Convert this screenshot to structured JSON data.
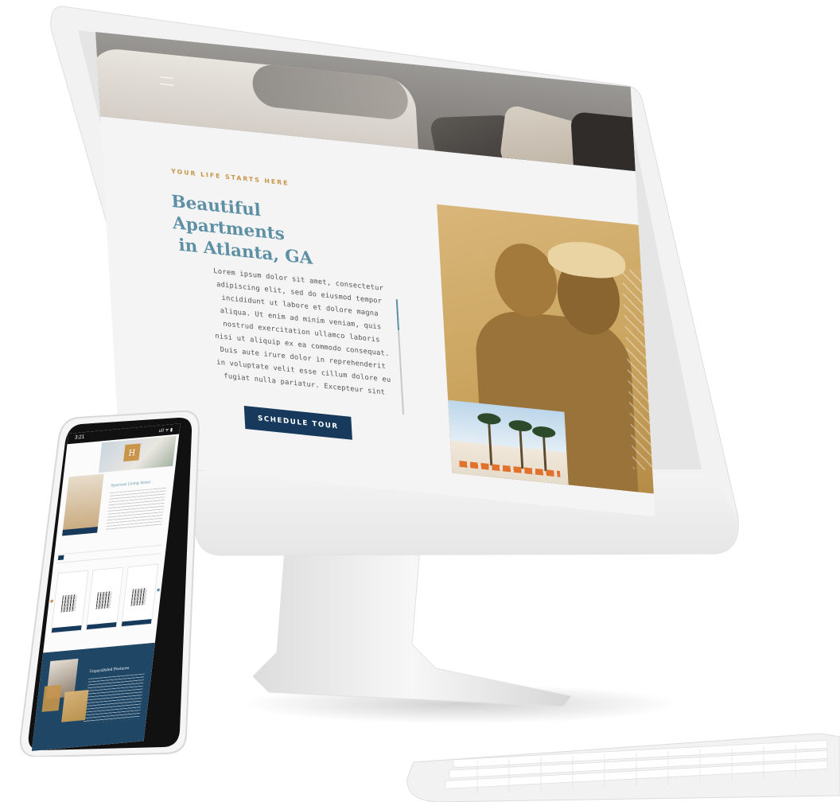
{
  "imac": {
    "hero": {
      "eyebrow": "YOUR LIFE STARTS HERE",
      "headline_line1": "Beautiful Apartments",
      "headline_line2": "in Atlanta, GA",
      "body": "Lorem ipsum dolor sit amet, consectetur adipiscing elit, sed do eiusmod tempor incididunt ut labore et dolore magna aliqua. Ut enim ad minim veniam, quis nostrud exercitation ullamco laboris nisi ut aliquip ex ea commodo consequat. Duis aute irure dolor in reprehenderit in voluptate velit esse cillum dolore eu fugiat nulla pariatur. Excepteur sint",
      "cta_label": "SCHEDULE TOUR"
    },
    "icons": {
      "menu": "hamburger-menu-icon"
    }
  },
  "phone": {
    "status_time": "3:21",
    "status_icons": "ull ᯤ ▮",
    "logo_glyph": "H",
    "section_title": "Spacious Living Areas",
    "dark_section_title": "Unparalleled Features"
  },
  "colors": {
    "navy": "#173a5c",
    "gold": "#c8954b",
    "teal": "#5d90a4",
    "screen_bg": "#f4f4f4"
  }
}
